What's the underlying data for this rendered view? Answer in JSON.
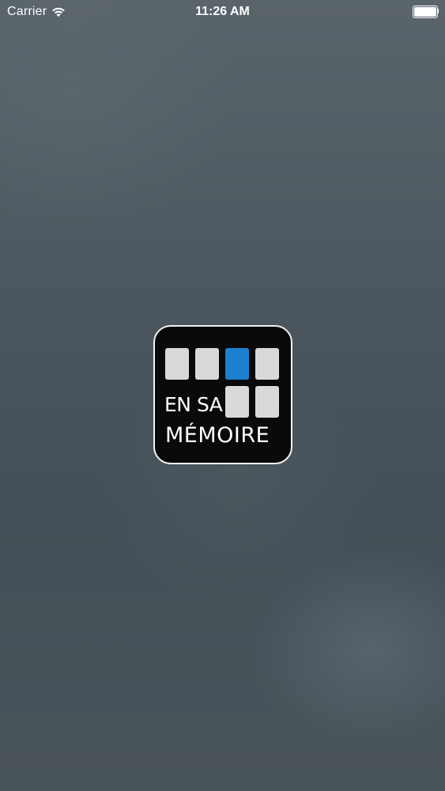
{
  "status_bar": {
    "carrier": "Carrier",
    "time": "11:26 AM",
    "wifi_icon": "wifi-icon",
    "battery_icon": "battery-icon",
    "battery_level": 1.0
  },
  "logo": {
    "line1": "EN SA",
    "line2": "MÉMOIRE",
    "accent_color": "#1b80cf",
    "tile_color": "#d9d9dc"
  }
}
